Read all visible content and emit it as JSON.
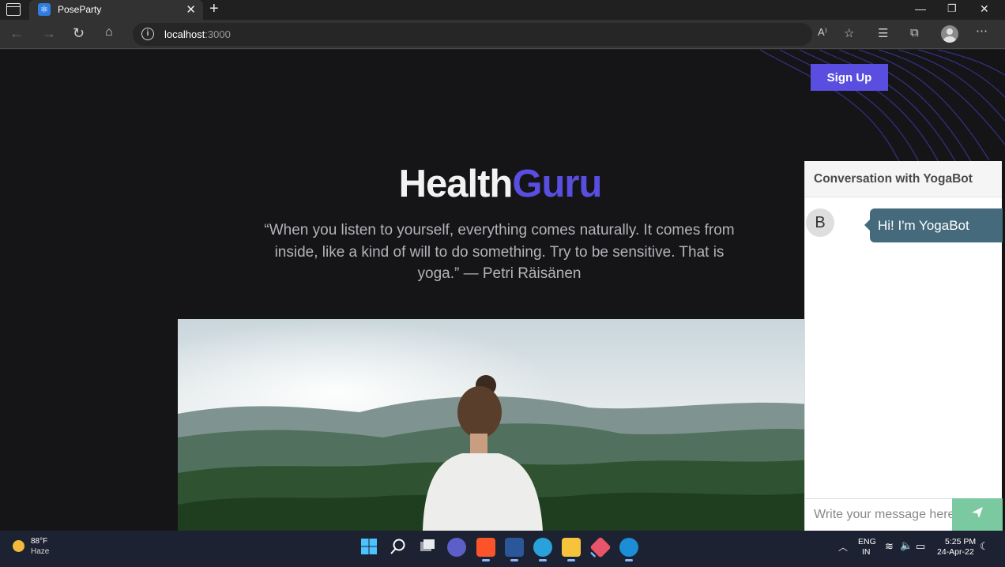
{
  "browser": {
    "tab_title": "PoseParty",
    "tab_close": "✕",
    "new_tab": "+",
    "url_host": "localhost",
    "url_port": ":3000"
  },
  "page": {
    "signup_label": "Sign Up",
    "brand_part1": "Health",
    "brand_part2": "Guru",
    "quote": "“When you listen to yourself, everything comes naturally. It comes from inside, like a kind of will to do something. Try to be sensitive. That is yoga.” — Petri Räisänen"
  },
  "chat": {
    "title": "Conversation with YogaBot",
    "avatar_letter": "B",
    "message": "Hi! I'm YogaBot",
    "input_placeholder": "Write your message here"
  },
  "taskbar": {
    "temperature": "88°F",
    "condition": "Haze",
    "lang_line1": "ENG",
    "lang_line2": "IN",
    "time": "5:25 PM",
    "date": "24-Apr-22"
  },
  "colors": {
    "accent": "#5a4ee0",
    "bubble": "#456a7c",
    "send": "#7bc9a0",
    "page_bg": "#151518"
  }
}
